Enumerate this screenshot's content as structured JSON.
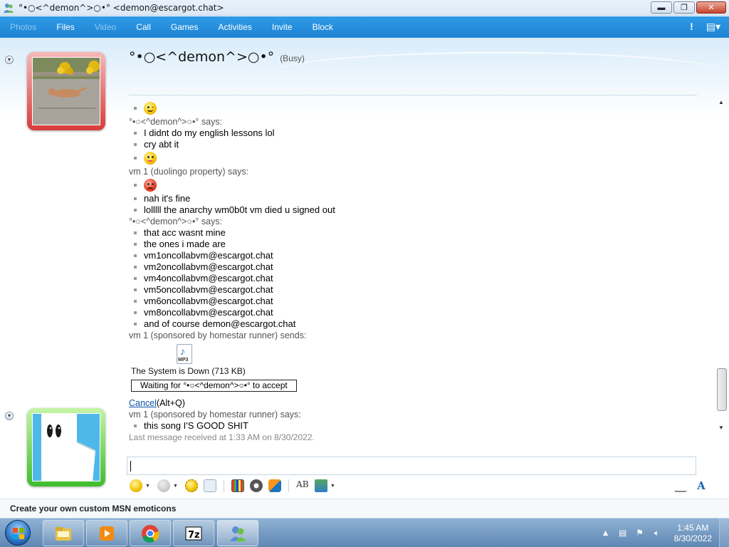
{
  "window": {
    "title": "°•○<^demon^>○•° <demon@escargot.chat>",
    "minimize": "▬",
    "maximize": "❐",
    "close": "✕"
  },
  "menu": {
    "items": [
      {
        "label": "Photos",
        "enabled": false
      },
      {
        "label": "Files",
        "enabled": true
      },
      {
        "label": "Video",
        "enabled": false
      },
      {
        "label": "Call",
        "enabled": true
      },
      {
        "label": "Games",
        "enabled": true
      },
      {
        "label": "Activities",
        "enabled": true
      },
      {
        "label": "Invite",
        "enabled": true
      },
      {
        "label": "Block",
        "enabled": true
      }
    ],
    "alert_icon": "!",
    "options_icon": "▤▾"
  },
  "contact": {
    "name": "°•○<^demon^>○•°",
    "status": "(Busy)",
    "status_color": "#d93b3b"
  },
  "messages": {
    "block1": {
      "emoticon": "wink"
    },
    "sender1": "°•○<^demon^>○•° says:",
    "block2": [
      "I didnt do my english lessons lol",
      "cry abt it"
    ],
    "sender2": "vm 1 (duolingo property) says:",
    "block3": [
      "nah it's fine",
      "lolllll the anarchy wm0b0t vm died u signed out"
    ],
    "sender3": "°•○<^demon^>○•° says:",
    "block4": [
      "that acc wasnt mine",
      "the ones i made are",
      "vm1oncollabvm@escargot.chat",
      "vm2oncollabvm@escargot.chat",
      "vm4oncollabvm@escargot.chat",
      "vm5oncollabvm@escargot.chat",
      "vm6oncollabvm@escargot.chat",
      "vm8oncollabvm@escargot.chat",
      "and of course demon@escargot.chat"
    ],
    "sender4": "vm 1 (sponsored by homestar runner) sends:",
    "file": {
      "ext": "MP3",
      "name": "The System is Down (713 KB)",
      "waiting": "Waiting for °•○<^demon^>○•° to accept",
      "cancel": "Cancel",
      "cancel_shortcut": "(Alt+Q)"
    },
    "sender5": "vm 1 (sponsored by homestar runner) says:",
    "block5": [
      "this song I'S GOOD SHIT"
    ],
    "last_received": "Last message received at 1:33 AM on 8/30/2022."
  },
  "statusbar": {
    "promo": "Create your own custom MSN emoticons"
  },
  "taskbar": {
    "apps": [
      "explorer",
      "media-player",
      "chrome",
      "7zip",
      "messenger"
    ],
    "time": "1:45 AM",
    "date": "8/30/2022"
  },
  "colors": {
    "menubar": "#1e83d3",
    "busy_frame": "#d93b3b",
    "online_frame": "#3dbd2c",
    "link": "#0b56a8"
  }
}
